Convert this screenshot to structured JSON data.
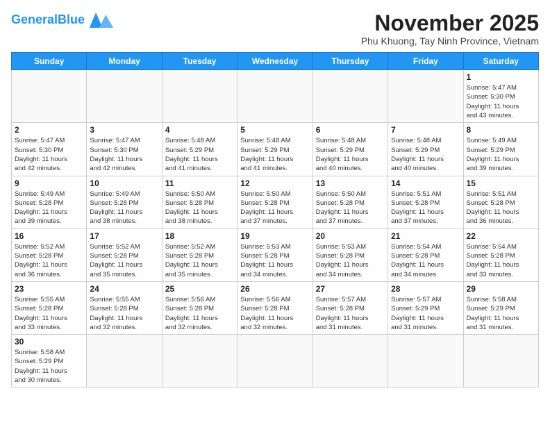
{
  "header": {
    "logo_general": "General",
    "logo_blue": "Blue",
    "month_title": "November 2025",
    "location": "Phu Khuong, Tay Ninh Province, Vietnam"
  },
  "days_of_week": [
    "Sunday",
    "Monday",
    "Tuesday",
    "Wednesday",
    "Thursday",
    "Friday",
    "Saturday"
  ],
  "weeks": [
    [
      {
        "day": null,
        "info": null
      },
      {
        "day": null,
        "info": null
      },
      {
        "day": null,
        "info": null
      },
      {
        "day": null,
        "info": null
      },
      {
        "day": null,
        "info": null
      },
      {
        "day": null,
        "info": null
      },
      {
        "day": "1",
        "info": "Sunrise: 5:47 AM\nSunset: 5:30 PM\nDaylight: 11 hours\nand 43 minutes."
      }
    ],
    [
      {
        "day": "2",
        "info": "Sunrise: 5:47 AM\nSunset: 5:30 PM\nDaylight: 11 hours\nand 42 minutes."
      },
      {
        "day": "3",
        "info": "Sunrise: 5:47 AM\nSunset: 5:30 PM\nDaylight: 11 hours\nand 42 minutes."
      },
      {
        "day": "4",
        "info": "Sunrise: 5:48 AM\nSunset: 5:29 PM\nDaylight: 11 hours\nand 41 minutes."
      },
      {
        "day": "5",
        "info": "Sunrise: 5:48 AM\nSunset: 5:29 PM\nDaylight: 11 hours\nand 41 minutes."
      },
      {
        "day": "6",
        "info": "Sunrise: 5:48 AM\nSunset: 5:29 PM\nDaylight: 11 hours\nand 40 minutes."
      },
      {
        "day": "7",
        "info": "Sunrise: 5:48 AM\nSunset: 5:29 PM\nDaylight: 11 hours\nand 40 minutes."
      },
      {
        "day": "8",
        "info": "Sunrise: 5:49 AM\nSunset: 5:29 PM\nDaylight: 11 hours\nand 39 minutes."
      }
    ],
    [
      {
        "day": "9",
        "info": "Sunrise: 5:49 AM\nSunset: 5:28 PM\nDaylight: 11 hours\nand 39 minutes."
      },
      {
        "day": "10",
        "info": "Sunrise: 5:49 AM\nSunset: 5:28 PM\nDaylight: 11 hours\nand 38 minutes."
      },
      {
        "day": "11",
        "info": "Sunrise: 5:50 AM\nSunset: 5:28 PM\nDaylight: 11 hours\nand 38 minutes."
      },
      {
        "day": "12",
        "info": "Sunrise: 5:50 AM\nSunset: 5:28 PM\nDaylight: 11 hours\nand 37 minutes."
      },
      {
        "day": "13",
        "info": "Sunrise: 5:50 AM\nSunset: 5:28 PM\nDaylight: 11 hours\nand 37 minutes."
      },
      {
        "day": "14",
        "info": "Sunrise: 5:51 AM\nSunset: 5:28 PM\nDaylight: 11 hours\nand 37 minutes."
      },
      {
        "day": "15",
        "info": "Sunrise: 5:51 AM\nSunset: 5:28 PM\nDaylight: 11 hours\nand 36 minutes."
      }
    ],
    [
      {
        "day": "16",
        "info": "Sunrise: 5:52 AM\nSunset: 5:28 PM\nDaylight: 11 hours\nand 36 minutes."
      },
      {
        "day": "17",
        "info": "Sunrise: 5:52 AM\nSunset: 5:28 PM\nDaylight: 11 hours\nand 35 minutes."
      },
      {
        "day": "18",
        "info": "Sunrise: 5:52 AM\nSunset: 5:28 PM\nDaylight: 11 hours\nand 35 minutes."
      },
      {
        "day": "19",
        "info": "Sunrise: 5:53 AM\nSunset: 5:28 PM\nDaylight: 11 hours\nand 34 minutes."
      },
      {
        "day": "20",
        "info": "Sunrise: 5:53 AM\nSunset: 5:28 PM\nDaylight: 11 hours\nand 34 minutes."
      },
      {
        "day": "21",
        "info": "Sunrise: 5:54 AM\nSunset: 5:28 PM\nDaylight: 11 hours\nand 34 minutes."
      },
      {
        "day": "22",
        "info": "Sunrise: 5:54 AM\nSunset: 5:28 PM\nDaylight: 11 hours\nand 33 minutes."
      }
    ],
    [
      {
        "day": "23",
        "info": "Sunrise: 5:55 AM\nSunset: 5:28 PM\nDaylight: 11 hours\nand 33 minutes."
      },
      {
        "day": "24",
        "info": "Sunrise: 5:55 AM\nSunset: 5:28 PM\nDaylight: 11 hours\nand 32 minutes."
      },
      {
        "day": "25",
        "info": "Sunrise: 5:56 AM\nSunset: 5:28 PM\nDaylight: 11 hours\nand 32 minutes."
      },
      {
        "day": "26",
        "info": "Sunrise: 5:56 AM\nSunset: 5:28 PM\nDaylight: 11 hours\nand 32 minutes."
      },
      {
        "day": "27",
        "info": "Sunrise: 5:57 AM\nSunset: 5:28 PM\nDaylight: 11 hours\nand 31 minutes."
      },
      {
        "day": "28",
        "info": "Sunrise: 5:57 AM\nSunset: 5:29 PM\nDaylight: 11 hours\nand 31 minutes."
      },
      {
        "day": "29",
        "info": "Sunrise: 5:58 AM\nSunset: 5:29 PM\nDaylight: 11 hours\nand 31 minutes."
      }
    ],
    [
      {
        "day": "30",
        "info": "Sunrise: 5:58 AM\nSunset: 5:29 PM\nDaylight: 11 hours\nand 30 minutes."
      },
      {
        "day": null,
        "info": null
      },
      {
        "day": null,
        "info": null
      },
      {
        "day": null,
        "info": null
      },
      {
        "day": null,
        "info": null
      },
      {
        "day": null,
        "info": null
      },
      {
        "day": null,
        "info": null
      }
    ]
  ]
}
